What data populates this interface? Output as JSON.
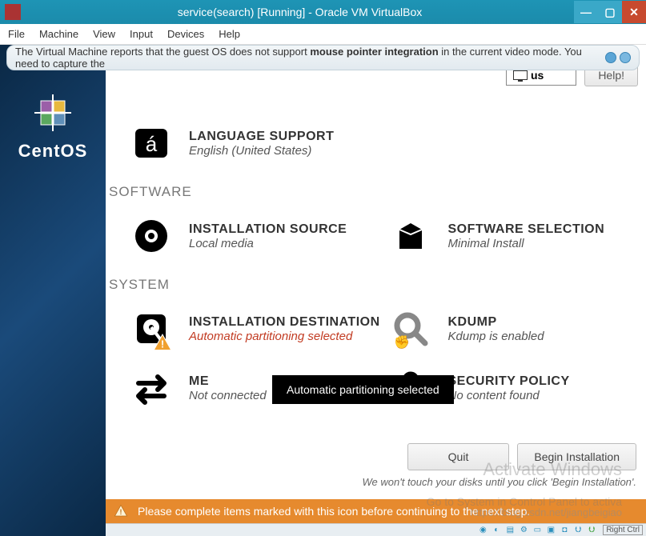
{
  "window": {
    "title": "service(search) [Running] - Oracle VM VirtualBox"
  },
  "menu": {
    "file": "File",
    "machine": "Machine",
    "view": "View",
    "input": "Input",
    "devices": "Devices",
    "help": "Help"
  },
  "notification": {
    "prefix": "The Virtual Machine reports that the guest OS does not support ",
    "bold": "mouse pointer integration",
    "suffix": " in the current video mode. You need to capture the"
  },
  "sidebar": {
    "brand": "CentOS"
  },
  "topright": {
    "lang": "us",
    "help": "Help!"
  },
  "installer": {
    "language_support": {
      "title": "LANGUAGE SUPPORT",
      "sub": "English (United States)"
    },
    "section_software": "SOFTWARE",
    "installation_source": {
      "title": "INSTALLATION SOURCE",
      "sub": "Local media"
    },
    "software_selection": {
      "title": "SOFTWARE SELECTION",
      "sub": "Minimal Install"
    },
    "section_system": "SYSTEM",
    "installation_destination": {
      "title": "INSTALLATION DESTINATION",
      "sub": "Automatic partitioning selected"
    },
    "kdump": {
      "title": "KDUMP",
      "sub": "Kdump is enabled"
    },
    "network": {
      "title": "ME",
      "sub": "Not connected"
    },
    "security": {
      "title": "SECURITY POLICY",
      "sub": "No content found"
    },
    "tooltip": "Automatic partitioning selected",
    "quit": "Quit",
    "begin": "Begin Installation",
    "note": "We won't touch your disks until you click 'Begin Installation'.",
    "warning": "Please complete items marked with this icon before continuing to the next step."
  },
  "watermark": {
    "activate": "Activate Windows",
    "goto": "Go to System in Control Panel to activa",
    "url": "https://blog.csdn.net/jiangbeigiao"
  },
  "status": {
    "rightctrl": "Right Ctrl"
  }
}
